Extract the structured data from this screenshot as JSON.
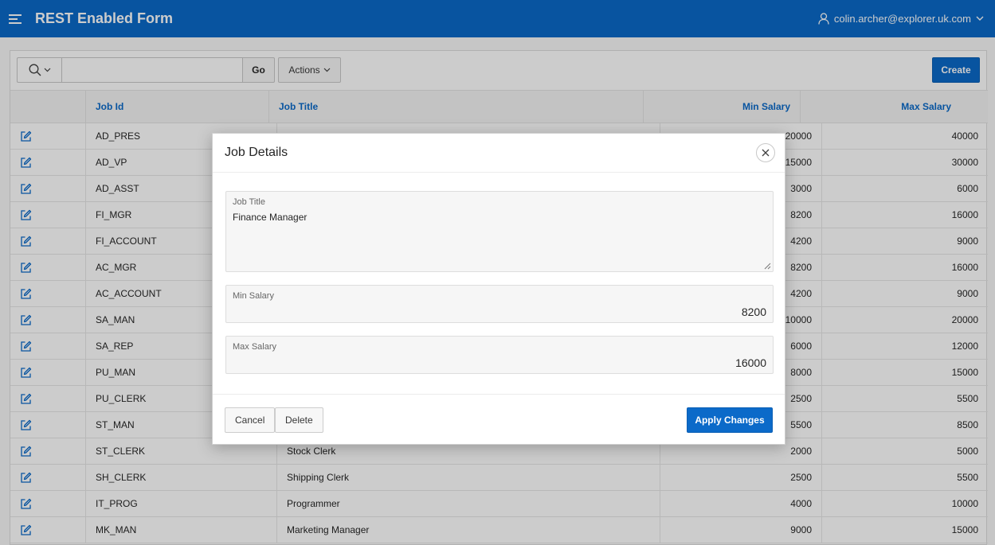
{
  "header": {
    "app_title": "REST Enabled Form",
    "user_name": "colin.archer@explorer.uk.com",
    "menu_icon": "hamburger-icon",
    "user_icon": "user-icon"
  },
  "toolbar": {
    "search_value": "",
    "go_label": "Go",
    "actions_label": "Actions",
    "create_label": "Create"
  },
  "table": {
    "columns": {
      "job_id": "Job Id",
      "job_title": "Job Title",
      "min_salary": "Min Salary",
      "max_salary": "Max Salary"
    },
    "rows": [
      {
        "job_id": "AD_PRES",
        "job_title": "",
        "min_salary": "20000",
        "max_salary": "40000"
      },
      {
        "job_id": "AD_VP",
        "job_title": "",
        "min_salary": "15000",
        "max_salary": "30000"
      },
      {
        "job_id": "AD_ASST",
        "job_title": "",
        "min_salary": "3000",
        "max_salary": "6000"
      },
      {
        "job_id": "FI_MGR",
        "job_title": "",
        "min_salary": "8200",
        "max_salary": "16000"
      },
      {
        "job_id": "FI_ACCOUNT",
        "job_title": "",
        "min_salary": "4200",
        "max_salary": "9000"
      },
      {
        "job_id": "AC_MGR",
        "job_title": "",
        "min_salary": "8200",
        "max_salary": "16000"
      },
      {
        "job_id": "AC_ACCOUNT",
        "job_title": "",
        "min_salary": "4200",
        "max_salary": "9000"
      },
      {
        "job_id": "SA_MAN",
        "job_title": "",
        "min_salary": "10000",
        "max_salary": "20000"
      },
      {
        "job_id": "SA_REP",
        "job_title": "",
        "min_salary": "6000",
        "max_salary": "12000"
      },
      {
        "job_id": "PU_MAN",
        "job_title": "",
        "min_salary": "8000",
        "max_salary": "15000"
      },
      {
        "job_id": "PU_CLERK",
        "job_title": "",
        "min_salary": "2500",
        "max_salary": "5500"
      },
      {
        "job_id": "ST_MAN",
        "job_title": "",
        "min_salary": "5500",
        "max_salary": "8500"
      },
      {
        "job_id": "ST_CLERK",
        "job_title": "Stock Clerk",
        "min_salary": "2000",
        "max_salary": "5000"
      },
      {
        "job_id": "SH_CLERK",
        "job_title": "Shipping Clerk",
        "min_salary": "2500",
        "max_salary": "5500"
      },
      {
        "job_id": "IT_PROG",
        "job_title": "Programmer",
        "min_salary": "4000",
        "max_salary": "10000"
      },
      {
        "job_id": "MK_MAN",
        "job_title": "Marketing Manager",
        "min_salary": "9000",
        "max_salary": "15000"
      }
    ]
  },
  "dialog": {
    "title": "Job Details",
    "job_title_label": "Job Title",
    "job_title_value": "Finance Manager",
    "min_salary_label": "Min Salary",
    "min_salary_value": "8200",
    "max_salary_label": "Max Salary",
    "max_salary_value": "16000",
    "cancel_label": "Cancel",
    "delete_label": "Delete",
    "apply_label": "Apply Changes"
  }
}
